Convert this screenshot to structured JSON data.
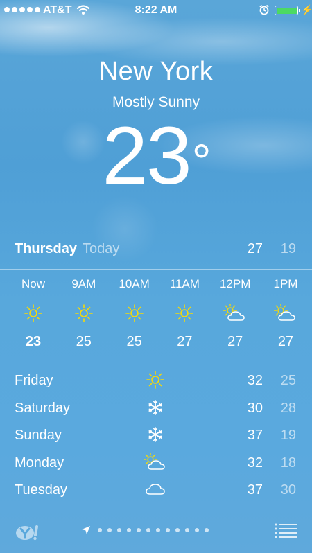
{
  "status_bar": {
    "carrier": "AT&T",
    "time": "8:22 AM",
    "battery_color": "#4cd964"
  },
  "current": {
    "city": "New York",
    "condition": "Mostly Sunny",
    "temperature": "23",
    "degree_symbol": "°"
  },
  "today": {
    "day": "Thursday",
    "label": "Today",
    "high": "27",
    "low": "19"
  },
  "hourly": [
    {
      "label": "Now",
      "icon": "sun-icon",
      "temp": "23"
    },
    {
      "label": "9AM",
      "icon": "sun-icon",
      "temp": "25"
    },
    {
      "label": "10AM",
      "icon": "sun-icon",
      "temp": "25"
    },
    {
      "label": "11AM",
      "icon": "sun-icon",
      "temp": "27"
    },
    {
      "label": "12PM",
      "icon": "partly-cloudy-icon",
      "temp": "27"
    },
    {
      "label": "1PM",
      "icon": "partly-cloudy-icon",
      "temp": "27"
    }
  ],
  "daily": [
    {
      "day": "Friday",
      "icon": "sun-icon",
      "high": "32",
      "low": "25"
    },
    {
      "day": "Saturday",
      "icon": "snowflake-icon",
      "high": "30",
      "low": "28"
    },
    {
      "day": "Sunday",
      "icon": "snowflake-icon",
      "high": "37",
      "low": "19"
    },
    {
      "day": "Monday",
      "icon": "partly-cloudy-icon",
      "high": "32",
      "low": "18"
    },
    {
      "day": "Tuesday",
      "icon": "cloud-icon",
      "high": "37",
      "low": "30"
    }
  ],
  "colors": {
    "sun": "#f5d90a",
    "background": "#56a6da"
  }
}
